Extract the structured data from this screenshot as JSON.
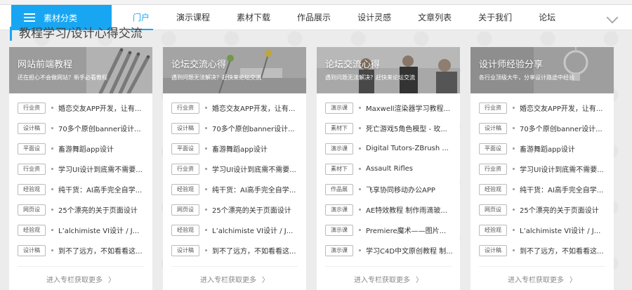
{
  "nav": {
    "category_button": "素材分类",
    "items": [
      {
        "label": "门户",
        "active": true
      },
      {
        "label": "演示课程",
        "active": false
      },
      {
        "label": "素材下载",
        "active": false
      },
      {
        "label": "作品展示",
        "active": false
      },
      {
        "label": "设计灵感",
        "active": false
      },
      {
        "label": "文章列表",
        "active": false
      },
      {
        "label": "关于我们",
        "active": false
      },
      {
        "label": "论坛",
        "active": false
      }
    ]
  },
  "section": {
    "title": "教程学习/设计心得交流"
  },
  "cards": [
    {
      "banner_title": "网站前端教程",
      "banner_subtitle": "还在担心不会做网站？新手必看教程",
      "rows": [
        {
          "tag": "行业资",
          "title": "婚恋交友APP开发，让有..."
        },
        {
          "tag": "设计稿",
          "title": "70多个原创banner设计..."
        },
        {
          "tag": "平面设",
          "title": "畜游舞蹈app设计"
        },
        {
          "tag": "行业资",
          "title": "学习UI设计到底需不需要..."
        },
        {
          "tag": "经验观",
          "title": "纯干货：AI高手完全自学..."
        },
        {
          "tag": "网页设",
          "title": "25个漂亮的关于页面设计"
        },
        {
          "tag": "经验观",
          "title": "L’alchimiste VI设计 / J..."
        },
        {
          "tag": "设计稿",
          "title": "到不了远方，不如看看这..."
        }
      ],
      "more": "进入专栏获取更多"
    },
    {
      "banner_title": "论坛交流心得",
      "banner_subtitle": "遇到问题无法解决？赶快来论坛交流",
      "rows": [
        {
          "tag": "行业资",
          "title": "婚恋交友APP开发，让有..."
        },
        {
          "tag": "设计稿",
          "title": "70多个原创banner设计..."
        },
        {
          "tag": "平面设",
          "title": "畜游舞蹈app设计"
        },
        {
          "tag": "行业资",
          "title": "学习UI设计到底需不需要..."
        },
        {
          "tag": "经验观",
          "title": "纯干货：AI高手完全自学..."
        },
        {
          "tag": "网页设",
          "title": "25个漂亮的关于页面设计"
        },
        {
          "tag": "经验观",
          "title": "L’alchimiste VI设计 / J..."
        },
        {
          "tag": "设计稿",
          "title": "到不了远方，不如看看这..."
        }
      ],
      "more": "进入专栏获取更多"
    },
    {
      "banner_title": "论坛交流心得",
      "banner_subtitle": "遇到问题无法解决？赶快来论坛交流",
      "rows": [
        {
          "tag": "演示课",
          "title": "Maxwell渲染器学习教程..."
        },
        {
          "tag": "素材下",
          "title": "死亡游戏5角色模型 - 玫..."
        },
        {
          "tag": "演示课",
          "title": "Digital Tutors-ZBrush ..."
        },
        {
          "tag": "素材下",
          "title": "Assault Rifles"
        },
        {
          "tag": "作品展",
          "title": "飞享协同移动办公APP"
        },
        {
          "tag": "演示课",
          "title": "AE特效教程 制作雨滴玻..."
        },
        {
          "tag": "演示课",
          "title": "Premiere魔术——图片..."
        },
        {
          "tag": "演示课",
          "title": "学习C4D中文原创教程 制..."
        }
      ],
      "more": "进入专栏获取更多"
    },
    {
      "banner_title": "设计师经验分享",
      "banner_subtitle": "各行业顶级大牛，分享设计路途中经验",
      "rows": [
        {
          "tag": "行业资",
          "title": "婚恋交友APP开发，让有..."
        },
        {
          "tag": "设计稿",
          "title": "70多个原创banner设计..."
        },
        {
          "tag": "平面设",
          "title": "畜游舞蹈app设计"
        },
        {
          "tag": "行业资",
          "title": "学习UI设计到底需不需要..."
        },
        {
          "tag": "经验观",
          "title": "纯干货：AI高手完全自学..."
        },
        {
          "tag": "网页设",
          "title": "25个漂亮的关于页面设计"
        },
        {
          "tag": "经验观",
          "title": "L’alchimiste VI设计 / J..."
        },
        {
          "tag": "设计稿",
          "title": "到不了远方，不如看看这..."
        }
      ],
      "more": "进入专栏获取更多"
    }
  ],
  "colors": {
    "accent": "#18a6f3"
  }
}
